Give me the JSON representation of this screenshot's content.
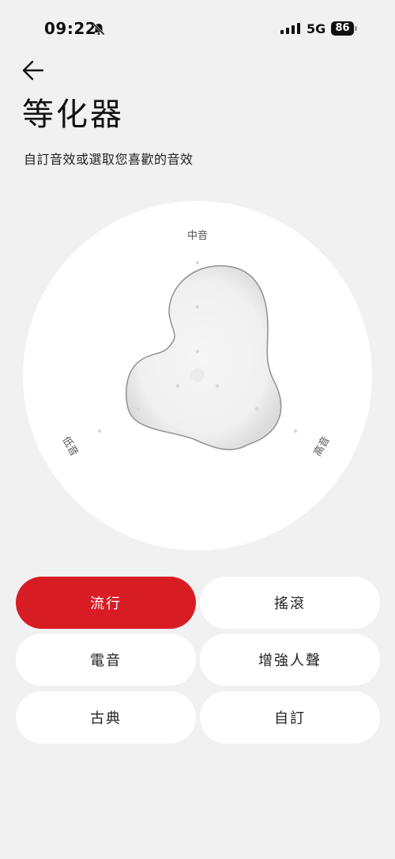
{
  "status_bar": {
    "time": "09:22",
    "network": "5G",
    "battery": "86"
  },
  "header": {
    "back_icon": "back-arrow-icon",
    "title": "等化器",
    "subtitle": "自訂音效或選取您喜歡的音效"
  },
  "equalizer": {
    "labels": {
      "mid": "中音",
      "low": "低音",
      "high": "高音"
    }
  },
  "presets": {
    "items": [
      {
        "label": "流行",
        "selected": true
      },
      {
        "label": "搖滾",
        "selected": false
      },
      {
        "label": "電音",
        "selected": false
      },
      {
        "label": "增強人聲",
        "selected": false
      },
      {
        "label": "古典",
        "selected": false
      },
      {
        "label": "自訂",
        "selected": false
      }
    ]
  },
  "colors": {
    "accent": "#d81c24",
    "background": "#f1f1f1",
    "card": "#ffffff"
  }
}
